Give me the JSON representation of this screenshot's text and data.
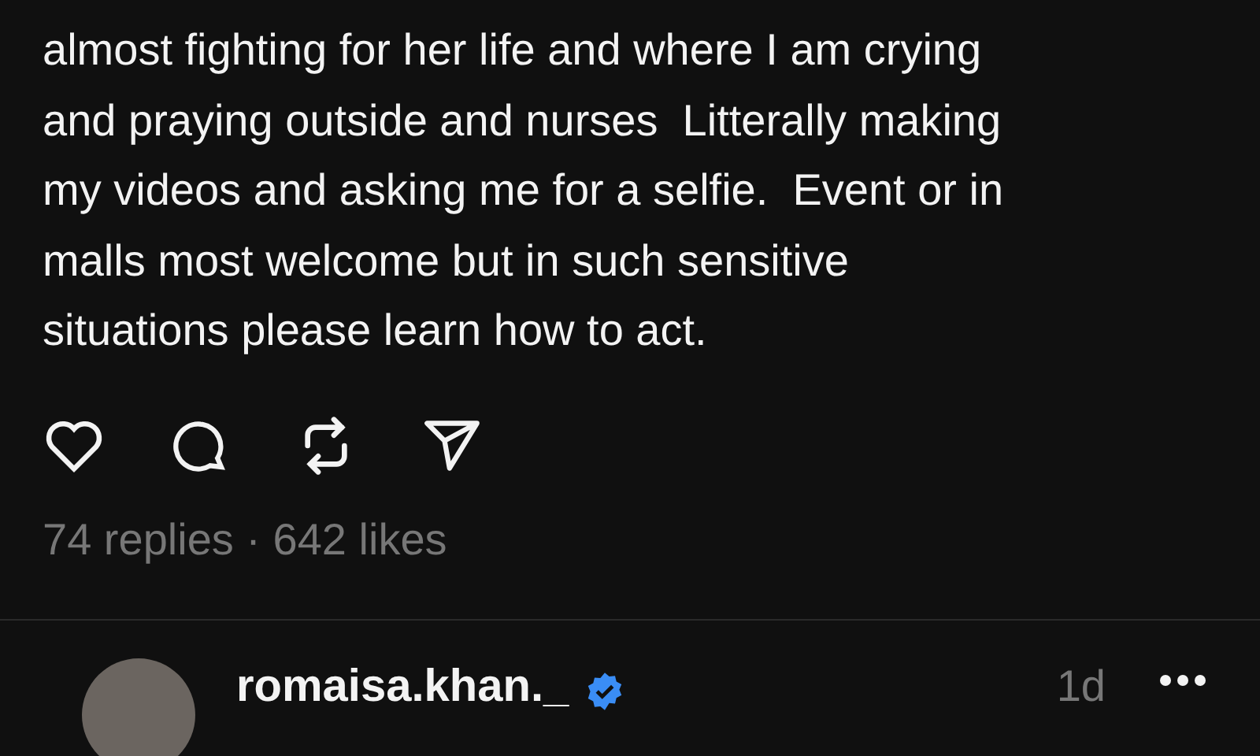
{
  "post": {
    "text": "almost fighting for her life and where I am crying\nand praying outside and nurses  Litterally making\nmy videos and asking me for a selfie.  Event or in\nmalls most welcome but in such sensitive\nsituations please learn how to act.",
    "stats": "74 replies · 642 likes"
  },
  "reply": {
    "username": "romaisa.khan._",
    "verified": true,
    "time": "1d"
  }
}
